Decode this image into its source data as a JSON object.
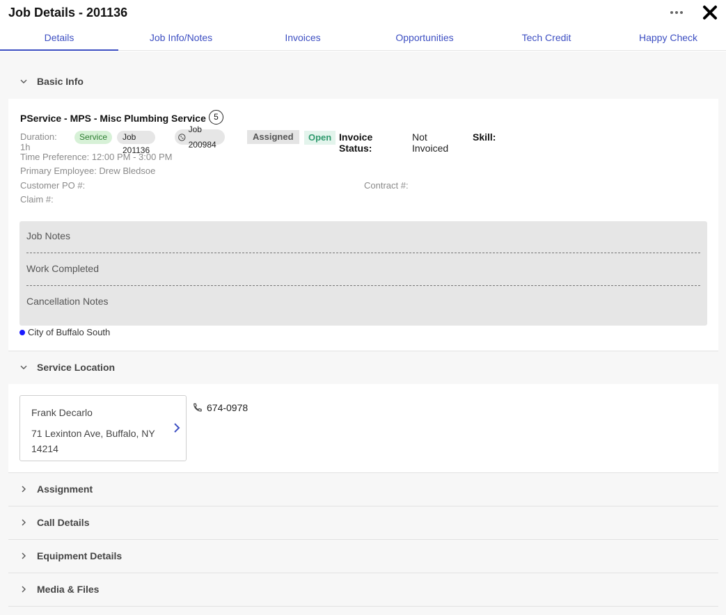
{
  "header": {
    "title": "Job Details - 201136",
    "more_icon": "more-horizontal-icon",
    "close_icon": "close-icon"
  },
  "tabs": [
    {
      "label": "Details",
      "active": true
    },
    {
      "label": "Job Info/Notes"
    },
    {
      "label": "Invoices"
    },
    {
      "label": "Opportunities"
    },
    {
      "label": "Tech Credit"
    },
    {
      "label": "Happy Check"
    }
  ],
  "basic_info": {
    "section_title": "Basic Info",
    "service_title": "PService - MPS - Misc Plumbing Service",
    "count": "5",
    "duration": "Duration: 1h",
    "service_badge": "Service",
    "job_badge": "Job 201136",
    "call_badge": "Job 200984",
    "assigned_tag": "Assigned",
    "open_tag": "Open",
    "invoice_status_label": "Invoice Status:",
    "invoice_status_value": "Not Invoiced",
    "skill_label": "Skill:",
    "time_preference": "Time Preference: 12:00 PM - 3:00 PM",
    "primary_employee": "Primary Employee: Drew Bledsoe",
    "customer_po": "Customer PO #:",
    "contract": "Contract #:",
    "claim": "Claim #:",
    "notes": {
      "job_notes": "Job Notes",
      "work_completed": "Work Completed",
      "cancellation_notes": "Cancellation Notes"
    },
    "zone": "City of Buffalo South",
    "colors": {
      "accent": "#3c4ec2",
      "service_badge_bg": "#d7f1d7",
      "open_tag_text": "#2f9a6e",
      "zone_dot": "#1a1aff"
    }
  },
  "service_location": {
    "section_title": "Service Location",
    "name": "Frank Decarlo",
    "address": "71 Lexinton Ave, Buffalo, NY 14214",
    "phone": "674-0978",
    "phone_icon": "phone-icon"
  },
  "collapsed_sections": [
    {
      "title": "Assignment"
    },
    {
      "title": "Call Details"
    },
    {
      "title": "Equipment Details"
    },
    {
      "title": "Media & Files"
    }
  ]
}
